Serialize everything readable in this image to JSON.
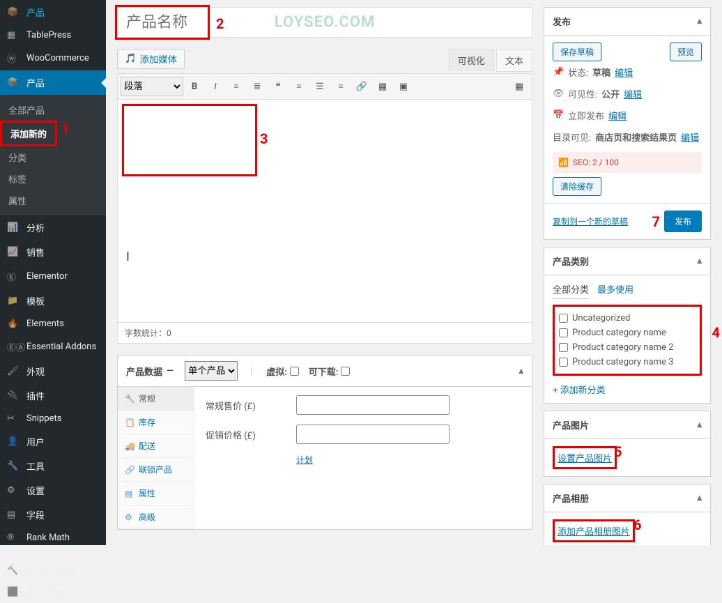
{
  "sidebar": {
    "items": [
      {
        "icon": "📦",
        "label": "产品"
      },
      {
        "icon": "▦",
        "label": "TablePress"
      },
      {
        "icon": "ⓦ",
        "label": "WooCommerce"
      }
    ],
    "active": {
      "icon": "📦",
      "label": "产品"
    },
    "submenu": [
      "全部产品",
      "添加新的",
      "分类",
      "标签",
      "属性"
    ],
    "rest": [
      {
        "icon": "📊",
        "label": "分析"
      },
      {
        "icon": "📈",
        "label": "销售"
      },
      {
        "icon": "Ⓔ",
        "label": "Elementor"
      },
      {
        "icon": "📁",
        "label": "模板"
      },
      {
        "icon": "🔥",
        "label": "Elements"
      },
      {
        "icon": "ⒺⒶ",
        "label": "Essential Addons"
      },
      {
        "icon": "🖌",
        "label": "外观"
      },
      {
        "icon": "🔌",
        "label": "插件"
      },
      {
        "icon": "✂",
        "label": "Snippets"
      },
      {
        "icon": "👤",
        "label": "用户"
      },
      {
        "icon": "🔧",
        "label": "工具"
      },
      {
        "icon": "⚙",
        "label": "设置"
      },
      {
        "icon": "▤",
        "label": "字段"
      },
      {
        "icon": "®",
        "label": "Rank Math"
      },
      {
        "icon": "🔨",
        "label": "Banhammer"
      },
      {
        "icon": "⬛",
        "label": "Blackhole"
      }
    ]
  },
  "title": {
    "placeholder": "产品名称"
  },
  "watermark": "LOYSEO.COM",
  "addMedia": {
    "label": "添加媒体"
  },
  "editorTabs": {
    "visual": "可视化",
    "text": "文本"
  },
  "toolbar": {
    "format": "段落"
  },
  "wordcount": {
    "label": "字数统计：",
    "value": 0
  },
  "productData": {
    "title": "产品数据",
    "typeLabel": "单个产品",
    "virtual": "虚拟:",
    "downloadable": "可下载:",
    "tabs": [
      "常规",
      "库存",
      "配送",
      "联锁产品",
      "属性",
      "高级"
    ],
    "tabIcons": [
      "🔧",
      "📋",
      "🚚",
      "🔗",
      "▤",
      "⚙"
    ],
    "regularPrice": "常规售价 (£)",
    "salePrice": "促销价格 (£)",
    "schedule": "计划"
  },
  "publish": {
    "title": "发布",
    "saveDraft": "保存草稿",
    "preview": "预览",
    "status": {
      "label": "状态:",
      "value": "草稿",
      "edit": "编辑"
    },
    "visibility": {
      "label": "可见性:",
      "value": "公开",
      "edit": "编辑"
    },
    "publishNow": {
      "label": "立即发布",
      "edit": "编辑"
    },
    "catalog": {
      "label": "目录可见:",
      "value": "商店页和搜索结果页",
      "edit": "编辑"
    },
    "seo": "SEO: 2 / 100",
    "clearCache": "清除缓存",
    "copyDraft": "复制到一个新的草稿",
    "publishBtn": "发布"
  },
  "categories": {
    "title": "产品类别",
    "tabAll": "全部分类",
    "tabMost": "最多使用",
    "items": [
      "Uncategorized",
      "Product category name",
      "Product category name 2",
      "Product category name 3"
    ],
    "addNew": "+ 添加新分类"
  },
  "productImage": {
    "title": "产品图片",
    "set": "设置产品图片"
  },
  "gallery": {
    "title": "产品相册",
    "add": "添加产品相册图片"
  },
  "annotations": {
    "a1": "1",
    "a2": "2",
    "a3": "3",
    "a4": "4",
    "a5": "5",
    "a6": "6",
    "a7": "7"
  }
}
